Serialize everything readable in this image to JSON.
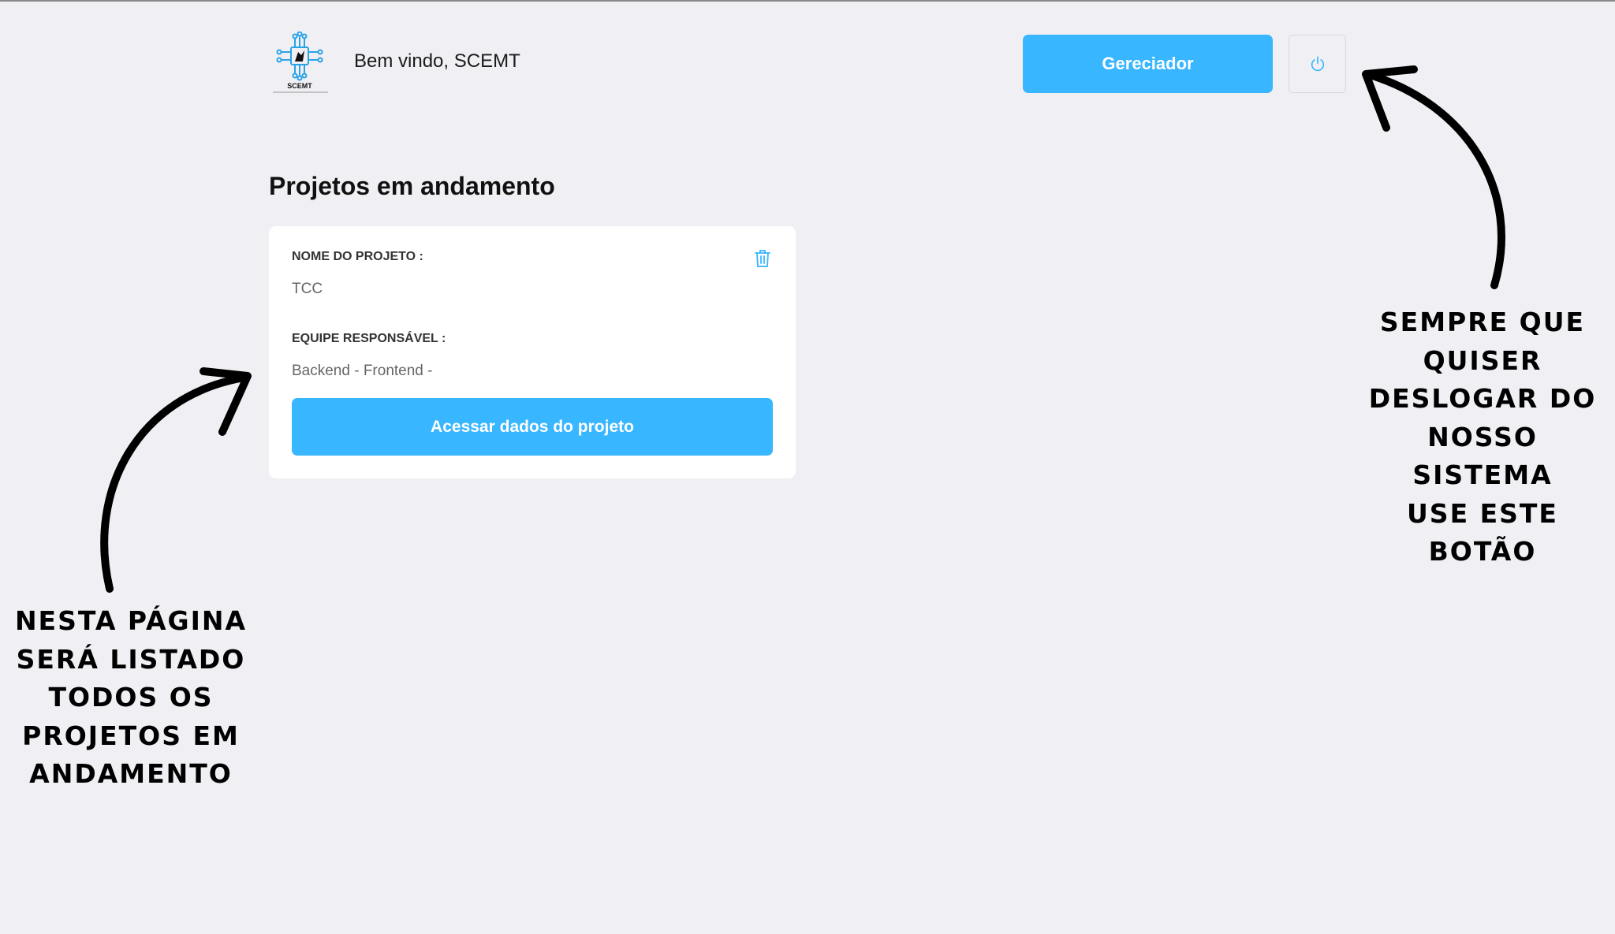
{
  "header": {
    "logo_text": "SCEMT",
    "welcome_text": "Bem vindo, SCEMT",
    "manager_button_label": "Gereciador",
    "logout_icon": "power-icon"
  },
  "main": {
    "section_title": "Projetos em andamento",
    "projects": [
      {
        "name_label": "NOME DO PROJETO :",
        "name_value": "TCC",
        "team_label": "EQUIPE RESPONSÁVEL :",
        "team_value": "Backend - Frontend -",
        "access_button_label": "Acessar dados do projeto",
        "delete_icon": "trash-icon"
      }
    ]
  },
  "annotations": {
    "left_lines": [
      "NESTA PÁGINA",
      "SERÁ LISTADO",
      "TODOS OS",
      "PROJETOS EM",
      "ANDAMENTO"
    ],
    "right_lines": [
      "SEMPRE QUE",
      "QUISER",
      "DESLOGAR DO",
      "NOSSO SISTEMA",
      "USE ESTE BOTÃO"
    ]
  },
  "colors": {
    "accent": "#38b6ff",
    "background": "#f0f0f4",
    "card": "#ffffff"
  }
}
